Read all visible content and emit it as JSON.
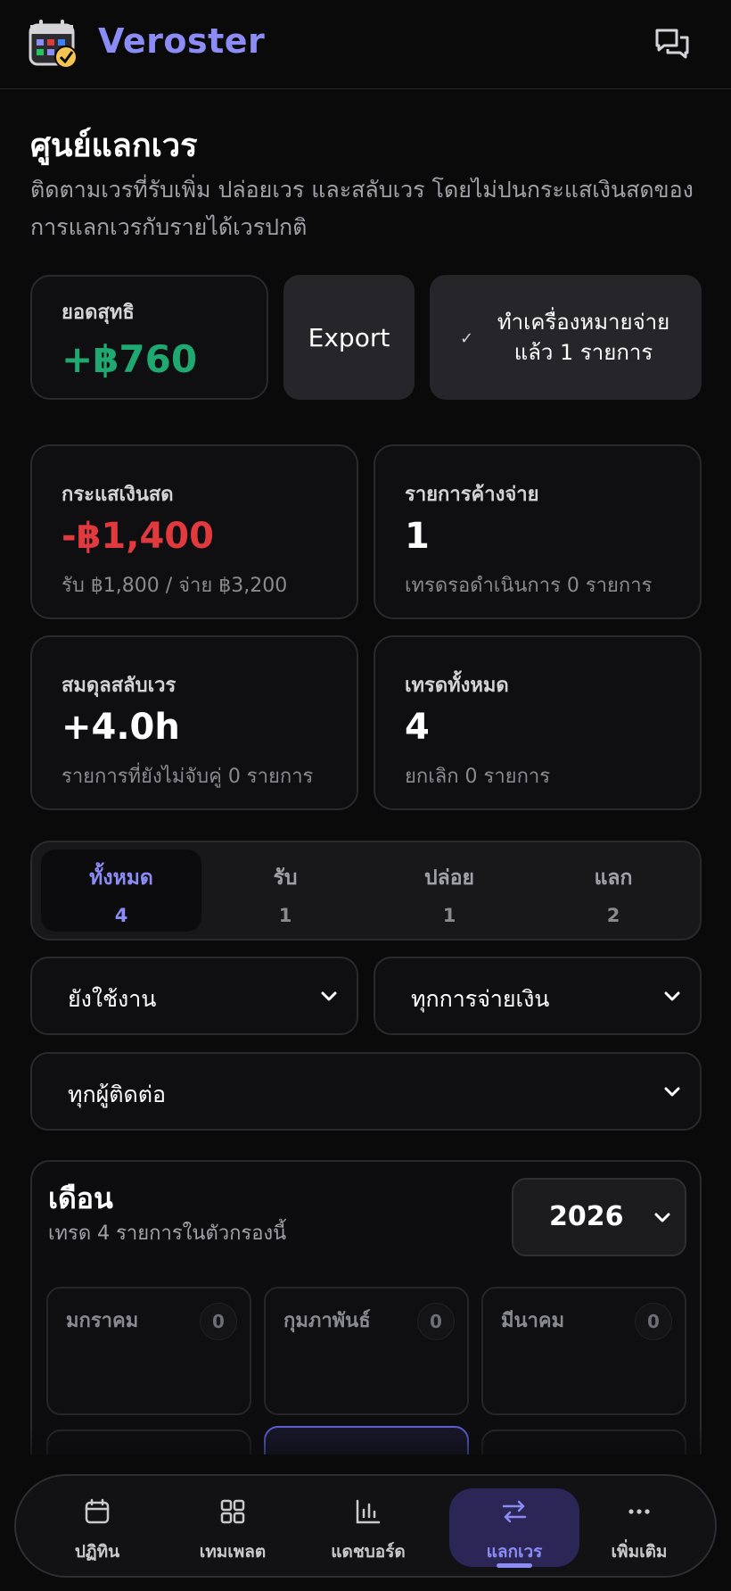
{
  "app": {
    "name": "Veroster",
    "accent": "#8b8cf5"
  },
  "page": {
    "title": "ศูนย์แลกเวร",
    "description": "ติดตามเวรที่รับเพิ่ม ปล่อยเวร และสลับเวร โดยไม่ปนกระแสเงินสดของการแลกเวรกับรายได้เวรปกติ"
  },
  "summary": {
    "net_label": "ยอดสุทธิ",
    "net_value": "+฿760",
    "net_color": "#1fa971",
    "export_label": "Export",
    "mark_paid_label": "ทำเครื่องหมายจ่ายแล้ว 1 รายการ"
  },
  "stats": [
    {
      "label": "กระแสเงินสด",
      "value": "-฿1,400",
      "sub": "รับ ฿1,800 / จ่าย ฿3,200"
    },
    {
      "label": "รายการค้างจ่าย",
      "value": "1",
      "sub": "เทรดรอดำเนินการ 0 รายการ"
    },
    {
      "label": "สมดุลสลับเวร",
      "value": "+4.0h",
      "sub": "รายการที่ยังไม่จับคู่ 0 รายการ"
    },
    {
      "label": "เทรดทั้งหมด",
      "value": "4",
      "sub": "ยกเลิก 0 รายการ"
    }
  ],
  "tabs": [
    {
      "label": "ทั้งหมด",
      "count": "4"
    },
    {
      "label": "รับ",
      "count": "1"
    },
    {
      "label": "ปล่อย",
      "count": "1"
    },
    {
      "label": "แลก",
      "count": "2"
    }
  ],
  "filters": {
    "status": "ยังใช้งาน",
    "payment": "ทุกการจ่ายเงิน",
    "contact": "ทุกผู้ติดต่อ"
  },
  "months": {
    "title": "เดือน",
    "subtitle": "เทรด 4 รายการในตัวกรองนี้",
    "year": "2026",
    "cells": [
      {
        "name": "มกราคม",
        "count": "0"
      },
      {
        "name": "กุมภาพันธ์",
        "count": "0"
      },
      {
        "name": "มีนาคม",
        "count": "0"
      }
    ]
  },
  "nav": [
    {
      "label": "ปฏิทิน",
      "icon": "calendar-icon"
    },
    {
      "label": "เทมเพลต",
      "icon": "grid-icon"
    },
    {
      "label": "แดชบอร์ด",
      "icon": "bar-chart-icon"
    },
    {
      "label": "แลกเวร",
      "icon": "swap-icon"
    },
    {
      "label": "เพิ่มเติม",
      "icon": "more-icon"
    }
  ]
}
